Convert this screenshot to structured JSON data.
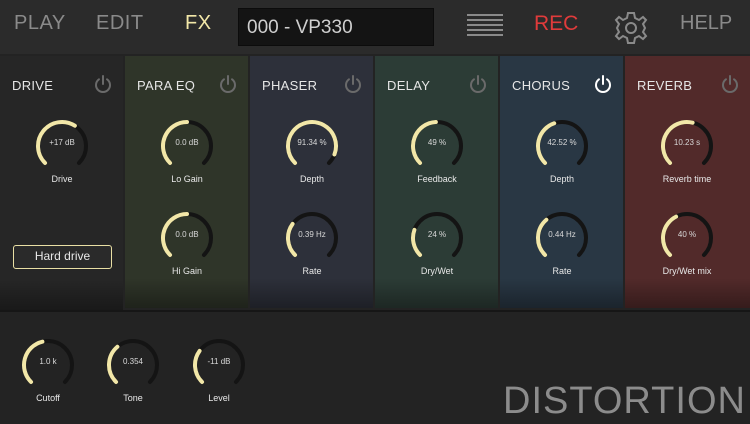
{
  "nav": {
    "play": "PLAY",
    "edit": "EDIT",
    "fx": "FX",
    "rec": "REC",
    "help": "HELP"
  },
  "preset": {
    "name": "000 - VP330"
  },
  "colors": {
    "accent": "#f2e7a8",
    "rec": "#e03b3b",
    "power_on": "#ffffff",
    "power_off": "#6a6a6a"
  },
  "icons": {
    "menu": "hamburger-lines-icon",
    "settings": "gear-icon",
    "power": "power-icon"
  },
  "panels": [
    {
      "title": "DRIVE",
      "power_on": false,
      "color": "#262626",
      "knobs": [
        {
          "value": "+17 dB",
          "label": "Drive",
          "level": 0.62
        }
      ],
      "button": "Hard drive"
    },
    {
      "title": "PARA EQ",
      "power_on": false,
      "color": "#2f3529",
      "knobs": [
        {
          "value": "0.0 dB",
          "label": "Lo Gain",
          "level": 0.5
        },
        {
          "value": "0.0 dB",
          "label": "Hi Gain",
          "level": 0.5
        }
      ]
    },
    {
      "title": "PHASER",
      "power_on": false,
      "color": "#2d303a",
      "knobs": [
        {
          "value": "91.34 %",
          "label": "Depth",
          "level": 0.91
        },
        {
          "value": "0.39  Hz",
          "label": "Rate",
          "level": 0.3
        }
      ]
    },
    {
      "title": "DELAY",
      "power_on": false,
      "color": "#2c3c36",
      "knobs": [
        {
          "value": "49   %",
          "label": "Feedback",
          "level": 0.49
        },
        {
          "value": "24   %",
          "label": "Dry/Wet",
          "level": 0.24
        }
      ]
    },
    {
      "title": "CHORUS",
      "power_on": true,
      "color": "#293744",
      "knobs": [
        {
          "value": "42.52 %",
          "label": "Depth",
          "level": 0.43
        },
        {
          "value": "0.44  Hz",
          "label": "Rate",
          "level": 0.35
        }
      ]
    },
    {
      "title": "REVERB",
      "power_on": false,
      "color": "#522a2a",
      "knobs": [
        {
          "value": "10.23 s",
          "label": "Reverb time",
          "level": 0.55
        },
        {
          "value": "40 %",
          "label": "Dry/Wet mix",
          "level": 0.4
        }
      ]
    }
  ],
  "distortion": {
    "name": "DISTORTION",
    "knobs": [
      {
        "value": "1.0 k",
        "label": "Cutoff",
        "level": 0.45
      },
      {
        "value": "0.354",
        "label": "Tone",
        "level": 0.35
      },
      {
        "value": "-11 dB",
        "label": "Level",
        "level": 0.3
      }
    ]
  }
}
